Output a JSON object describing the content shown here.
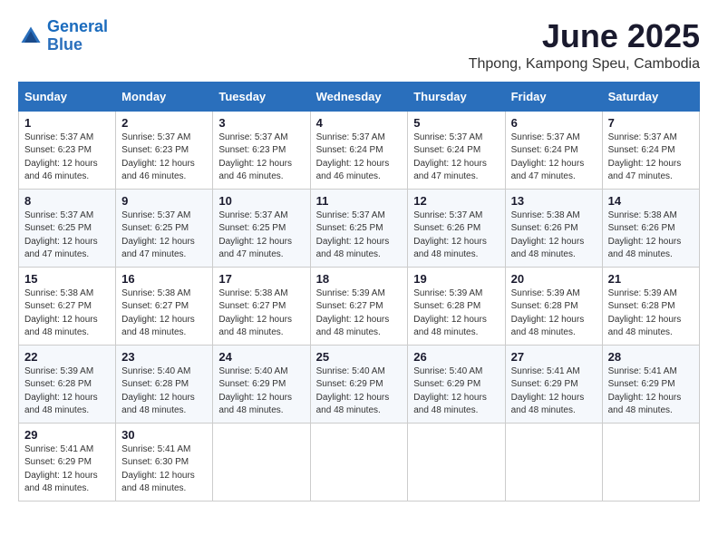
{
  "logo": {
    "line1": "General",
    "line2": "Blue"
  },
  "title": "June 2025",
  "location": "Thpong, Kampong Speu, Cambodia",
  "weekdays": [
    "Sunday",
    "Monday",
    "Tuesday",
    "Wednesday",
    "Thursday",
    "Friday",
    "Saturday"
  ],
  "weeks": [
    [
      {
        "day": "1",
        "sunrise": "5:37 AM",
        "sunset": "6:23 PM",
        "daylight": "12 hours and 46 minutes."
      },
      {
        "day": "2",
        "sunrise": "5:37 AM",
        "sunset": "6:23 PM",
        "daylight": "12 hours and 46 minutes."
      },
      {
        "day": "3",
        "sunrise": "5:37 AM",
        "sunset": "6:23 PM",
        "daylight": "12 hours and 46 minutes."
      },
      {
        "day": "4",
        "sunrise": "5:37 AM",
        "sunset": "6:24 PM",
        "daylight": "12 hours and 46 minutes."
      },
      {
        "day": "5",
        "sunrise": "5:37 AM",
        "sunset": "6:24 PM",
        "daylight": "12 hours and 47 minutes."
      },
      {
        "day": "6",
        "sunrise": "5:37 AM",
        "sunset": "6:24 PM",
        "daylight": "12 hours and 47 minutes."
      },
      {
        "day": "7",
        "sunrise": "5:37 AM",
        "sunset": "6:24 PM",
        "daylight": "12 hours and 47 minutes."
      }
    ],
    [
      {
        "day": "8",
        "sunrise": "5:37 AM",
        "sunset": "6:25 PM",
        "daylight": "12 hours and 47 minutes."
      },
      {
        "day": "9",
        "sunrise": "5:37 AM",
        "sunset": "6:25 PM",
        "daylight": "12 hours and 47 minutes."
      },
      {
        "day": "10",
        "sunrise": "5:37 AM",
        "sunset": "6:25 PM",
        "daylight": "12 hours and 47 minutes."
      },
      {
        "day": "11",
        "sunrise": "5:37 AM",
        "sunset": "6:25 PM",
        "daylight": "12 hours and 48 minutes."
      },
      {
        "day": "12",
        "sunrise": "5:37 AM",
        "sunset": "6:26 PM",
        "daylight": "12 hours and 48 minutes."
      },
      {
        "day": "13",
        "sunrise": "5:38 AM",
        "sunset": "6:26 PM",
        "daylight": "12 hours and 48 minutes."
      },
      {
        "day": "14",
        "sunrise": "5:38 AM",
        "sunset": "6:26 PM",
        "daylight": "12 hours and 48 minutes."
      }
    ],
    [
      {
        "day": "15",
        "sunrise": "5:38 AM",
        "sunset": "6:27 PM",
        "daylight": "12 hours and 48 minutes."
      },
      {
        "day": "16",
        "sunrise": "5:38 AM",
        "sunset": "6:27 PM",
        "daylight": "12 hours and 48 minutes."
      },
      {
        "day": "17",
        "sunrise": "5:38 AM",
        "sunset": "6:27 PM",
        "daylight": "12 hours and 48 minutes."
      },
      {
        "day": "18",
        "sunrise": "5:39 AM",
        "sunset": "6:27 PM",
        "daylight": "12 hours and 48 minutes."
      },
      {
        "day": "19",
        "sunrise": "5:39 AM",
        "sunset": "6:28 PM",
        "daylight": "12 hours and 48 minutes."
      },
      {
        "day": "20",
        "sunrise": "5:39 AM",
        "sunset": "6:28 PM",
        "daylight": "12 hours and 48 minutes."
      },
      {
        "day": "21",
        "sunrise": "5:39 AM",
        "sunset": "6:28 PM",
        "daylight": "12 hours and 48 minutes."
      }
    ],
    [
      {
        "day": "22",
        "sunrise": "5:39 AM",
        "sunset": "6:28 PM",
        "daylight": "12 hours and 48 minutes."
      },
      {
        "day": "23",
        "sunrise": "5:40 AM",
        "sunset": "6:28 PM",
        "daylight": "12 hours and 48 minutes."
      },
      {
        "day": "24",
        "sunrise": "5:40 AM",
        "sunset": "6:29 PM",
        "daylight": "12 hours and 48 minutes."
      },
      {
        "day": "25",
        "sunrise": "5:40 AM",
        "sunset": "6:29 PM",
        "daylight": "12 hours and 48 minutes."
      },
      {
        "day": "26",
        "sunrise": "5:40 AM",
        "sunset": "6:29 PM",
        "daylight": "12 hours and 48 minutes."
      },
      {
        "day": "27",
        "sunrise": "5:41 AM",
        "sunset": "6:29 PM",
        "daylight": "12 hours and 48 minutes."
      },
      {
        "day": "28",
        "sunrise": "5:41 AM",
        "sunset": "6:29 PM",
        "daylight": "12 hours and 48 minutes."
      }
    ],
    [
      {
        "day": "29",
        "sunrise": "5:41 AM",
        "sunset": "6:29 PM",
        "daylight": "12 hours and 48 minutes."
      },
      {
        "day": "30",
        "sunrise": "5:41 AM",
        "sunset": "6:30 PM",
        "daylight": "12 hours and 48 minutes."
      },
      null,
      null,
      null,
      null,
      null
    ]
  ]
}
